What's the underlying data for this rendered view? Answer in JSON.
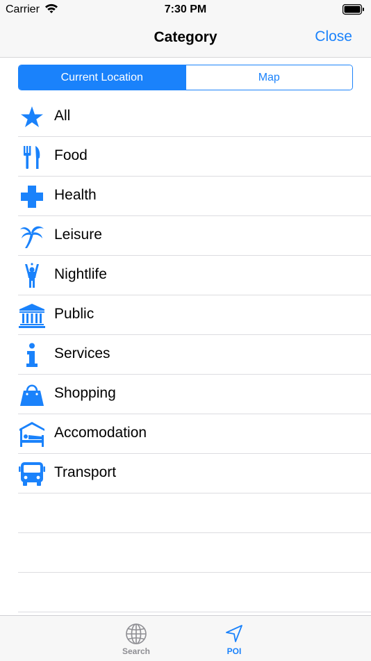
{
  "status_bar": {
    "carrier": "Carrier",
    "time": "7:30 PM"
  },
  "nav": {
    "title": "Category",
    "close_label": "Close"
  },
  "segmented": {
    "current_location": "Current Location",
    "map": "Map"
  },
  "categories": [
    {
      "label": "All",
      "icon": "star-icon"
    },
    {
      "label": "Food",
      "icon": "fork-knife-icon"
    },
    {
      "label": "Health",
      "icon": "cross-icon"
    },
    {
      "label": "Leisure",
      "icon": "palm-tree-icon"
    },
    {
      "label": "Nightlife",
      "icon": "dancer-icon"
    },
    {
      "label": "Public",
      "icon": "building-icon"
    },
    {
      "label": "Services",
      "icon": "info-icon"
    },
    {
      "label": "Shopping",
      "icon": "shopping-bag-icon"
    },
    {
      "label": "Accomodation",
      "icon": "bed-icon"
    },
    {
      "label": "Transport",
      "icon": "bus-icon"
    }
  ],
  "tab_bar": {
    "search_label": "Search",
    "poi_label": "POI"
  },
  "colors": {
    "accent": "#1a82fb",
    "inactive_tab": "#8e8e93",
    "bar_background": "#f7f7f7"
  }
}
